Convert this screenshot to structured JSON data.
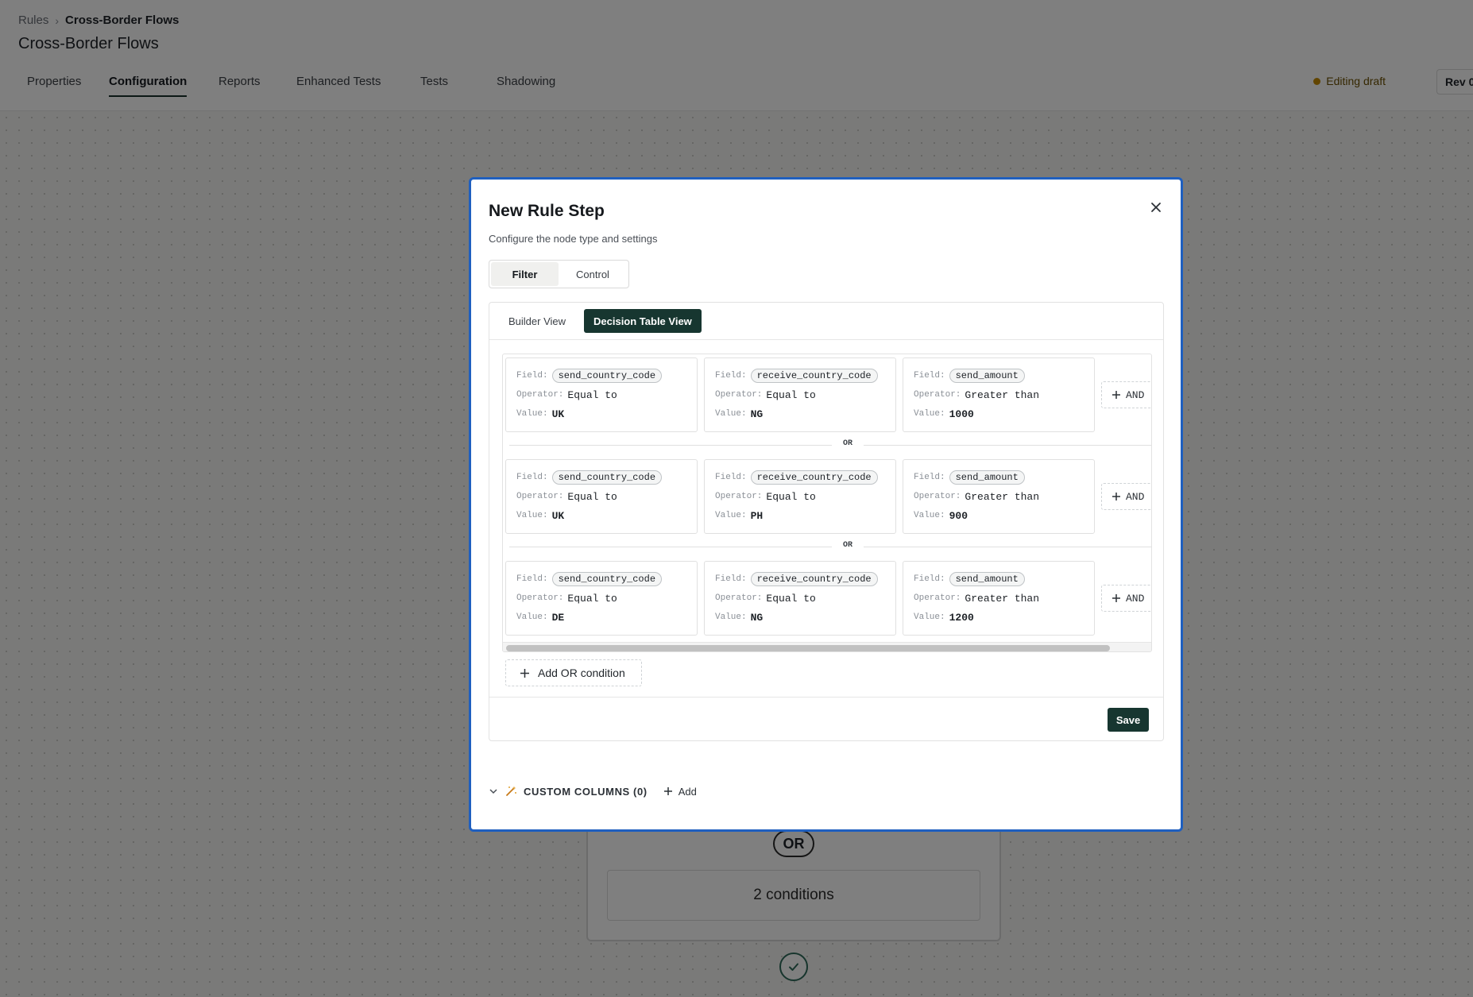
{
  "breadcrumb": {
    "root": "Rules",
    "current": "Cross-Border Flows"
  },
  "page": {
    "title": "Cross-Border Flows"
  },
  "tabs": [
    {
      "label": "Properties"
    },
    {
      "label": "Configuration",
      "active": true
    },
    {
      "label": "Reports"
    },
    {
      "label": "Enhanced Tests"
    },
    {
      "label": "Tests"
    },
    {
      "label": "Shadowing"
    }
  ],
  "status": {
    "label": "Editing draft",
    "color": "#c48a00"
  },
  "revision": {
    "label": "Rev 0"
  },
  "canvas": {
    "or_label": "OR",
    "conditions_label": "2 conditions"
  },
  "modal": {
    "title": "New Rule Step",
    "subtitle": "Configure the node type and settings",
    "node_types": [
      {
        "label": "Filter",
        "active": true
      },
      {
        "label": "Control"
      }
    ],
    "views": [
      {
        "label": "Builder View"
      },
      {
        "label": "Decision Table View",
        "active": true
      }
    ],
    "labels": {
      "field": "Field:",
      "operator": "Operator:",
      "value": "Value:"
    },
    "rows": [
      {
        "conditions": [
          {
            "field": "send_country_code",
            "operator": "Equal to",
            "value": "UK"
          },
          {
            "field": "receive_country_code",
            "operator": "Equal to",
            "value": "NG"
          },
          {
            "field": "send_amount",
            "operator": "Greater than",
            "value": "1000"
          }
        ]
      },
      {
        "conditions": [
          {
            "field": "send_country_code",
            "operator": "Equal to",
            "value": "UK"
          },
          {
            "field": "receive_country_code",
            "operator": "Equal to",
            "value": "PH"
          },
          {
            "field": "send_amount",
            "operator": "Greater than",
            "value": "900"
          }
        ]
      },
      {
        "conditions": [
          {
            "field": "send_country_code",
            "operator": "Equal to",
            "value": "DE"
          },
          {
            "field": "receive_country_code",
            "operator": "Equal to",
            "value": "NG"
          },
          {
            "field": "send_amount",
            "operator": "Greater than",
            "value": "1200"
          }
        ]
      }
    ],
    "and_label": "AND",
    "or_separator": "OR",
    "add_or_label": "Add OR condition",
    "save_label": "Save",
    "custom_columns": {
      "label": "CUSTOM COLUMNS (0)",
      "add_label": "Add"
    }
  },
  "colors": {
    "primary_dark": "#173630",
    "modal_focus_border": "#1f5fbf",
    "draft_dot": "#c48a00"
  }
}
